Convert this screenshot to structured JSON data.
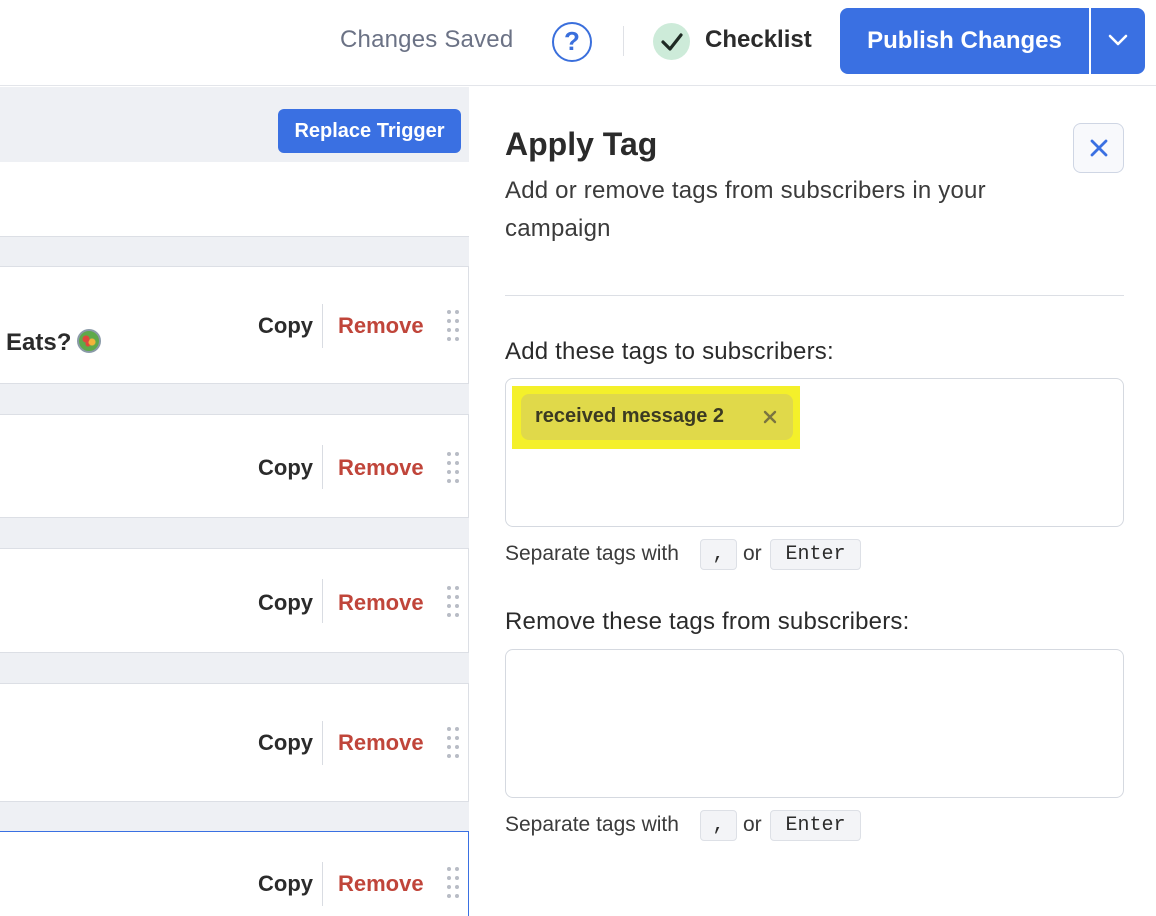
{
  "header": {
    "save_status": "Changes Saved",
    "help_glyph": "?",
    "checklist_label": "Checklist",
    "publish_label": "Publish Changes",
    "accent_color": "#3a70e2"
  },
  "flow": {
    "replace_trigger_label": "Replace Trigger",
    "cards": [
      {
        "message_fragment": "Eats?",
        "copy_label": "Copy",
        "remove_label": "Remove"
      },
      {
        "copy_label": "Copy",
        "remove_label": "Remove"
      },
      {
        "copy_label": "Copy",
        "remove_label": "Remove"
      },
      {
        "copy_label": "Copy",
        "remove_label": "Remove"
      },
      {
        "copy_label": "Copy",
        "remove_label": "Remove"
      }
    ]
  },
  "panel": {
    "title": "Apply Tag",
    "subtitle": "Add or remove tags from subscribers in your campaign",
    "add_label": "Add these tags to subscribers:",
    "add_tags": [
      "received message 2"
    ],
    "remove_label": "Remove these tags from subscribers:",
    "remove_tags": [],
    "hint_prefix": "Separate tags with",
    "hint_or": "or",
    "key_comma": ",",
    "key_enter": "Enter"
  },
  "icons": {
    "help": "question-circle-icon",
    "checklist": "check-icon",
    "publish_dropdown": "chevron-down-icon",
    "close": "close-icon",
    "tag_remove": "close-icon",
    "drag": "drag-handle-icon",
    "emoji": "salad-emoji-icon"
  },
  "colors": {
    "remove_text": "#c0453a",
    "tag_background": "#e0d94a",
    "highlight": "#f4f02a",
    "check_background": "#cdebd9"
  }
}
